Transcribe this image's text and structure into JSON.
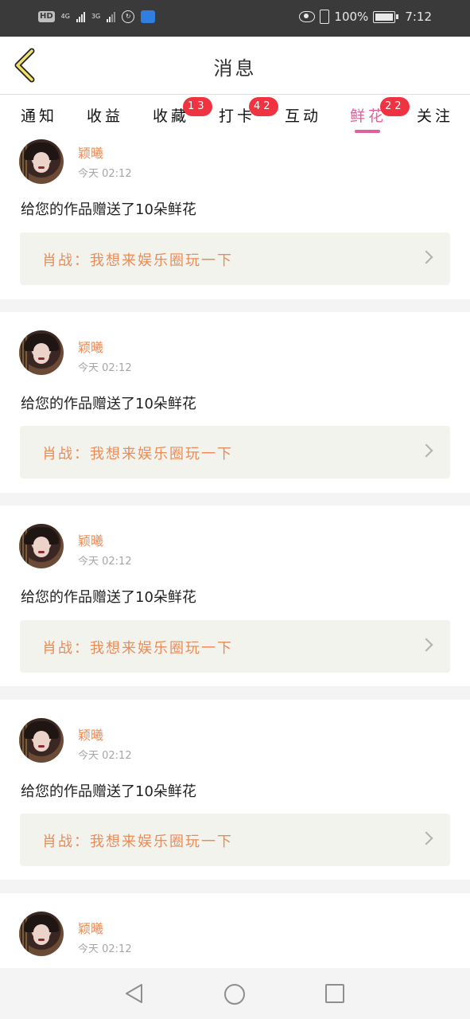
{
  "status_bar": {
    "hd": "HD",
    "network1": "4G",
    "network2": "3G",
    "battery_percent": "100%",
    "time": "7:12"
  },
  "header": {
    "title": "消息",
    "back_icon": "chevron-left-icon"
  },
  "tabs": [
    {
      "label": "通知",
      "badge": ""
    },
    {
      "label": "收益",
      "badge": ""
    },
    {
      "label": "收藏",
      "badge": "13"
    },
    {
      "label": "打卡",
      "badge": "42"
    },
    {
      "label": "互动",
      "badge": ""
    },
    {
      "label": "鲜花",
      "badge": "22",
      "active": true
    },
    {
      "label": "关注",
      "badge": ""
    }
  ],
  "messages": [
    {
      "user": "颖曦",
      "time": "今天 02:12",
      "text": "给您的作品赠送了10朵鲜花",
      "work": "肖战：我想来娱乐圈玩一下"
    },
    {
      "user": "颖曦",
      "time": "今天 02:12",
      "text": "给您的作品赠送了10朵鲜花",
      "work": "肖战：我想来娱乐圈玩一下"
    },
    {
      "user": "颖曦",
      "time": "今天 02:12",
      "text": "给您的作品赠送了10朵鲜花",
      "work": "肖战：我想来娱乐圈玩一下"
    },
    {
      "user": "颖曦",
      "time": "今天 02:12",
      "text": "给您的作品赠送了10朵鲜花",
      "work": "肖战：我想来娱乐圈玩一下"
    },
    {
      "user": "颖曦",
      "time": "今天 02:12"
    }
  ],
  "colors": {
    "accent": "#e0619a",
    "username": "#e88d5a",
    "badge": "#ef3340",
    "status_bar": "#3a3a3a"
  }
}
